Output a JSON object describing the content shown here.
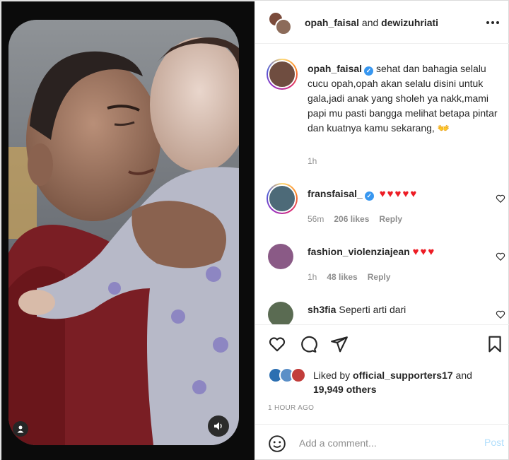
{
  "header": {
    "user1": "opah_faisal",
    "joiner": "and",
    "user2": "dewizuhriati"
  },
  "caption": {
    "username": "opah_faisal",
    "text": "sehat dan bahagia selalu cucu opah,opah akan selalu disini untuk gala,jadi anak yang sholeh ya nakk,mami papi mu pasti bangga melihat betapa pintar dan kuatnya kamu sekarang,",
    "emoji": "👐",
    "time": "1h"
  },
  "comments": [
    {
      "username": "fransfaisal_",
      "verified": true,
      "text": "♥♥♥♥♥",
      "time": "56m",
      "likes": "206 likes",
      "reply": "Reply"
    },
    {
      "username": "fashion_violenziajean",
      "verified": false,
      "text": "♥♥♥",
      "time": "1h",
      "likes": "48 likes",
      "reply": "Reply"
    },
    {
      "username": "sh3fia",
      "verified": false,
      "text": "Seperti arti dari",
      "time": "",
      "likes": "",
      "reply": ""
    }
  ],
  "likes": {
    "prefix": "Liked by",
    "user": "official_supporters17",
    "and": "and",
    "others": "19,949 others"
  },
  "timestamp": "1 HOUR AGO",
  "add_comment": {
    "placeholder": "Add a comment...",
    "post": "Post"
  },
  "icons": {
    "like": "heart-outline-icon",
    "comment": "comment-bubble-icon",
    "share": "paper-plane-icon",
    "save": "bookmark-icon",
    "emoji": "smiley-icon",
    "more": "more-dots-icon",
    "sound": "speaker-icon",
    "tag": "user-tag-icon"
  },
  "colors": {
    "verified": "#3897f0",
    "heart": "#ed1c24",
    "post_disabled": "#b2dffc",
    "muted": "#8e8e8e"
  }
}
